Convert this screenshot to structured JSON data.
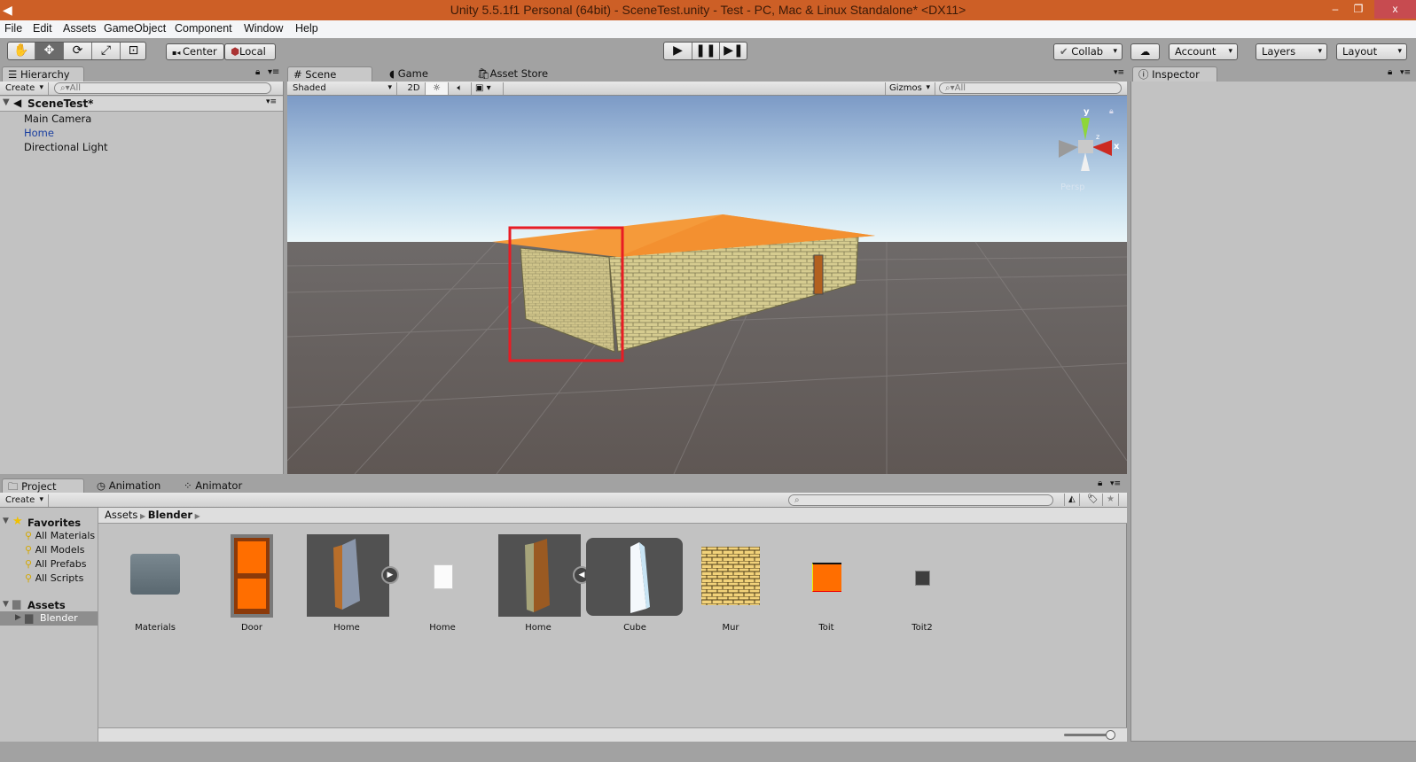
{
  "window": {
    "title": "Unity 5.5.1f1 Personal (64bit) - SceneTest.unity - Test - PC, Mac & Linux Standalone* <DX11>",
    "minimize": "–",
    "restore": "❐",
    "close": "x"
  },
  "menu": [
    "File",
    "Edit",
    "Assets",
    "GameObject",
    "Component",
    "Window",
    "Help"
  ],
  "toolbar": {
    "tools": [
      "hand-tool",
      "move-tool",
      "rotate-tool",
      "scale-tool",
      "rect-tool"
    ],
    "active_tool": "move-tool",
    "pivot": "Center",
    "space": "Local",
    "collab": "Collab",
    "account": "Account",
    "layers": "Layers",
    "layout": "Layout"
  },
  "hierarchy": {
    "tab": "Hierarchy",
    "create": "Create",
    "search_placeholder": "All",
    "scene": "SceneTest*",
    "items": [
      {
        "label": "Main Camera"
      },
      {
        "label": "Home",
        "color": "#1a3fa0"
      },
      {
        "label": "Directional Light"
      }
    ]
  },
  "scene": {
    "tabs": [
      "Scene",
      "Game",
      "Asset Store"
    ],
    "active_tab": "Scene",
    "shading": "Shaded",
    "mode_2d": "2D",
    "gizmos": "Gizmos",
    "search_placeholder": "All",
    "gizmo_labels": {
      "y": "y",
      "x": "x",
      "z": "z"
    },
    "projection": "Persp",
    "highlight_color": "#e81c24"
  },
  "inspector": {
    "tab": "Inspector"
  },
  "project": {
    "tabs": [
      "Project",
      "Animation",
      "Animator"
    ],
    "active_tab": "Project",
    "create": "Create",
    "breadcrumb": [
      "Assets",
      "Blender"
    ],
    "favorites": {
      "label": "Favorites",
      "items": [
        "All Materials",
        "All Models",
        "All Prefabs",
        "All Scripts"
      ]
    },
    "assets_root": "Assets",
    "selected_folder": "Blender",
    "assets": [
      {
        "name": "Materials",
        "icon": "folder-icon"
      },
      {
        "name": "Door",
        "icon": "door-texture"
      },
      {
        "name": "Home",
        "icon": "model-prefab"
      },
      {
        "name": "Home",
        "icon": "file-icon"
      },
      {
        "name": "Home",
        "icon": "model-prefab"
      },
      {
        "name": "Cube",
        "icon": "mesh"
      },
      {
        "name": "Mur",
        "icon": "brick-texture"
      },
      {
        "name": "Toit",
        "icon": "orange-material"
      },
      {
        "name": "Toit2",
        "icon": "dark-material"
      }
    ],
    "thumbnail_size": 0.9
  }
}
